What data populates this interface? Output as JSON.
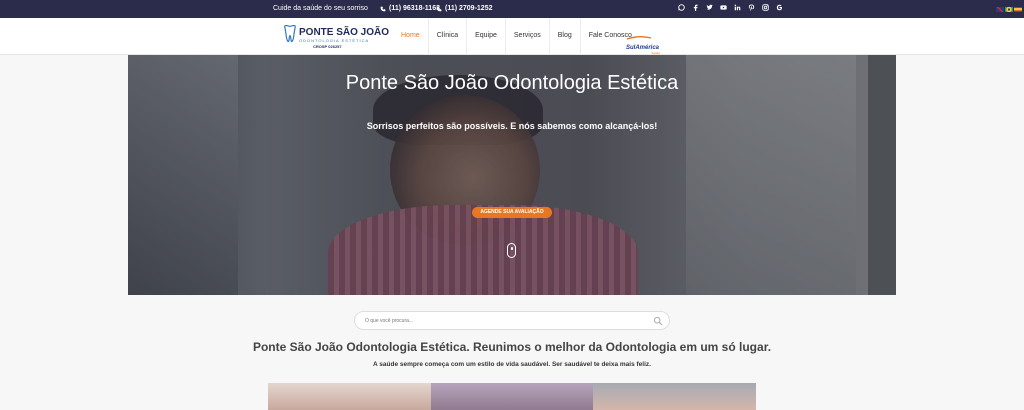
{
  "topbar": {
    "tagline": "Cuide da saúde do seu sorriso",
    "phone1": "(11) 96318-1163",
    "phone2": "(11) 2709-1252",
    "social_icons": [
      "whatsapp-icon",
      "facebook-icon",
      "twitter-icon",
      "youtube-icon",
      "linkedin-icon",
      "pinterest-icon",
      "instagram-icon",
      "google-icon"
    ],
    "flags": [
      "uk-flag",
      "brazil-flag",
      "spain-flag"
    ]
  },
  "logo": {
    "name": "PONTE SÃO JOÃO",
    "sub": "ODONTOLOGIA ESTÉTICA",
    "cro": "CROSP 026257"
  },
  "nav": {
    "items": [
      "Home",
      "Clínica",
      "Equipe",
      "Serviços",
      "Blog",
      "Fale Conosco"
    ],
    "active": "Home"
  },
  "partner": {
    "name": "SulAmérica",
    "sub": "Saúde"
  },
  "hero": {
    "title": "Ponte São João Odontologia Estética",
    "subtitle": "Sorrisos perfeitos são possíveis. E nós sabemos como alcançá-los!",
    "cta_label": "AGENDE SUA AVALIAÇÃO"
  },
  "search": {
    "placeholder": "O que você procura..."
  },
  "content": {
    "headline": "Ponte São João Odontologia Estética. Reunimos o melhor da Odontologia em um só lugar.",
    "tagline": "A saúde sempre começa com um estilo de vida saudável. Ser saudável te deixa mais feliz."
  },
  "colors": {
    "accent": "#e87722",
    "topbar": "#2b2b4b",
    "brand_navy": "#1f2a5a"
  }
}
